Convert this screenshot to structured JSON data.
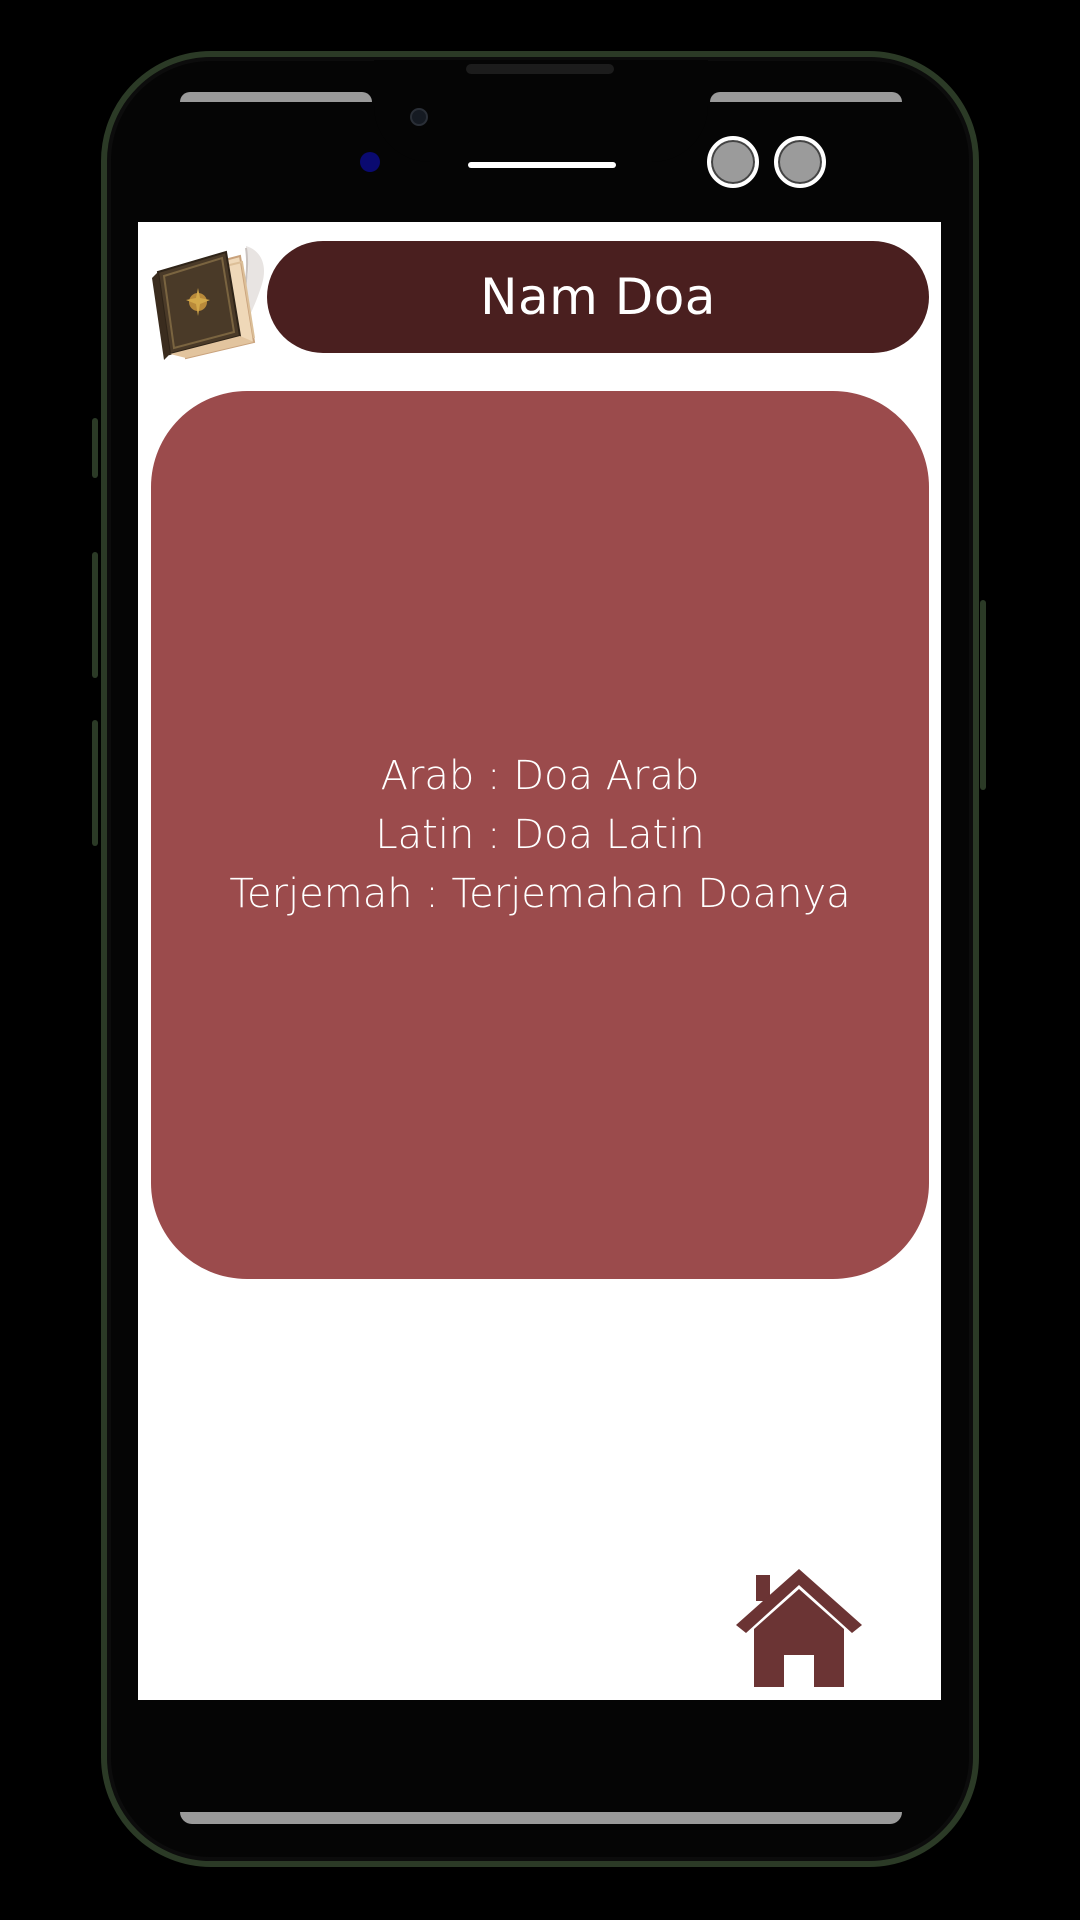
{
  "header": {
    "title": "Nam Doa"
  },
  "card": {
    "arab_line": "Arab : Doa Arab",
    "latin_line": "Latin : Doa Latin",
    "terjemah_line": "Terjemah : Terjemahan Doanya"
  },
  "icons": {
    "logo": "book-quill-icon",
    "home": "home-icon"
  },
  "colors": {
    "title_bar": "#4a1f1f",
    "card": "#9b4b4c",
    "home_icon": "#6b3434",
    "screen_bg": "#ffffff"
  }
}
